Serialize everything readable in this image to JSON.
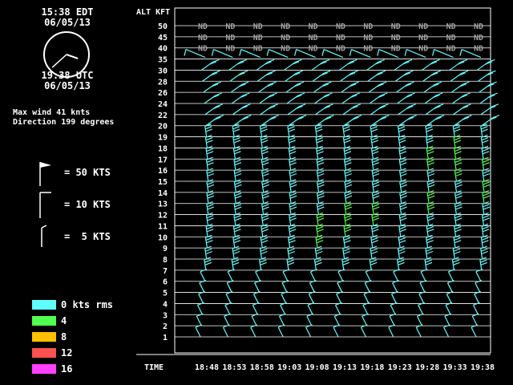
{
  "clock": {
    "local_time": "15:38 EDT",
    "local_date": "06/05/13",
    "utc_time": "19:38 UTC",
    "utc_date": "06/05/13",
    "hour_hand_angle_deg": 109,
    "minute_hand_angle_deg": 228
  },
  "summary": {
    "max_wind": "Max wind 41 knts",
    "direction": "Direction 199 degrees"
  },
  "barb_key": [
    {
      "label": "= 50 KTS",
      "type": "pennant"
    },
    {
      "label": "= 10 KTS",
      "type": "full"
    },
    {
      "label": "=  5 KTS",
      "type": "half"
    }
  ],
  "rms_legend": [
    {
      "label": "0 kts rms",
      "color": "#60ffff"
    },
    {
      "label": "4",
      "color": "#50ff50"
    },
    {
      "label": "8",
      "color": "#ffc000"
    },
    {
      "label": "12",
      "color": "#ff5050"
    },
    {
      "label": "16",
      "color": "#ff40ff"
    }
  ],
  "chart_data": {
    "type": "wind-profiler-time-height",
    "y_axis_title": "ALT KFT",
    "x_axis_title": "TIME",
    "altitude_labels": [
      "1",
      "2",
      "3",
      "4",
      "5",
      "6",
      "7",
      "8",
      "9",
      "10",
      "11",
      "12",
      "13",
      "14",
      "15",
      "16",
      "17",
      "18",
      "19",
      "20",
      "22",
      "24",
      "26",
      "28",
      "30",
      "35",
      "40",
      "45",
      "50"
    ],
    "times": [
      "18:48",
      "18:53",
      "18:58",
      "19:03",
      "19:08",
      "19:13",
      "19:18",
      "19:23",
      "19:28",
      "19:33",
      "19:38"
    ],
    "no_data_label": "ND",
    "no_data_levels": [
      "40",
      "45",
      "50"
    ],
    "green_barbs": [
      {
        "time": "19:08",
        "levels": [
          "9",
          "10",
          "11"
        ]
      },
      {
        "time": "19:13",
        "levels": [
          "10",
          "11",
          "12"
        ]
      },
      {
        "time": "19:18",
        "levels": [
          "11",
          "12"
        ]
      },
      {
        "time": "19:28",
        "levels": [
          "12",
          "13",
          "16",
          "17"
        ]
      },
      {
        "time": "19:33",
        "levels": [
          "15",
          "16",
          "17",
          "18"
        ]
      },
      {
        "time": "19:38",
        "levels": [
          "13",
          "14",
          "16"
        ]
      }
    ],
    "max_wind_kts": 41,
    "max_wind_direction_deg": 199
  },
  "colors": {
    "grid": "#ffffff",
    "barb_default": "#60ffff",
    "barb_green": "#50ff50",
    "no_data": "#a0a0a0"
  }
}
